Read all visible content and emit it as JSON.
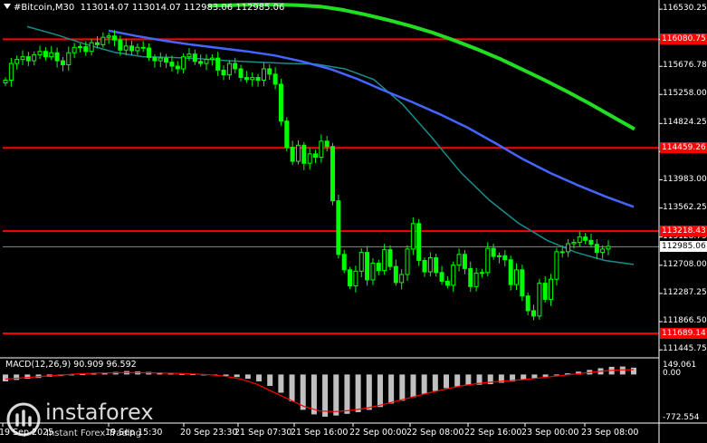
{
  "header": {
    "symbol": "#Bitcoin,M30",
    "ohlc": "113014.07 113014.07 112983.06 112985.06"
  },
  "macd": {
    "label": "MACD(12,26,9) 90.909 96.592"
  },
  "price_axis": {
    "ticks": [
      "116530.25",
      "116076.50",
      "115676.78",
      "115258.00",
      "114824.25",
      "114403.75",
      "113983.00",
      "113562.25",
      "113128.75",
      "112708.00",
      "112287.25",
      "111866.50",
      "111445.75"
    ],
    "tick_values": [
      116530.25,
      116076.5,
      115676.78,
      115258.0,
      114824.25,
      114403.75,
      113983.0,
      113562.25,
      113128.75,
      112708.0,
      112287.25,
      111866.5,
      111445.75
    ]
  },
  "levels": [
    {
      "label": "116080.75",
      "value": 116080.75
    },
    {
      "label": "114459.26",
      "value": 114459.26
    },
    {
      "label": "113218.43",
      "value": 113218.43
    },
    {
      "label": "111689.14",
      "value": 111689.14
    }
  ],
  "current_price": {
    "label": "112985.06",
    "value": 112985.06
  },
  "macd_axis": {
    "ticks": [
      "149.061",
      "0.00",
      "-772.554"
    ],
    "tick_values": [
      149.061,
      0,
      -772.554
    ]
  },
  "time_axis": [
    "19 Sep 2025",
    "19 Sep 15:30",
    "20 Sep 23:30",
    "21 Sep 07:30",
    "21 Sep 16:00",
    "22 Sep 00:00",
    "22 Sep 08:00",
    "22 Sep 16:00",
    "23 Sep 00:00",
    "23 Sep 08:00"
  ],
  "watermark": {
    "name": "instaforex",
    "tagline": "Instant Forex Trading"
  },
  "colors": {
    "background": "#000000",
    "candle": "#00ff00",
    "level": "#ff0000",
    "ma_slow": "#22dd22",
    "ma_mid": "#4466ff",
    "ma_fast": "#1a8c8c",
    "macd_hist": "#c0c0c0",
    "macd_signal": "#ff0000",
    "grid": "#444444"
  },
  "chart_data": {
    "type": "candlestick",
    "ylim": [
      111340,
      116640
    ],
    "close": [
      115470,
      115720,
      115780,
      115820,
      115760,
      115850,
      115900,
      115820,
      115880,
      115760,
      115700,
      115880,
      115960,
      115970,
      115900,
      116030,
      116000,
      116110,
      116130,
      116070,
      115920,
      115980,
      115910,
      115960,
      115950,
      115810,
      115760,
      115800,
      115740,
      115680,
      115640,
      115820,
      115860,
      115750,
      115720,
      115780,
      115800,
      115620,
      115550,
      115720,
      115640,
      115510,
      115480,
      115510,
      115470,
      115640,
      115560,
      115410,
      114860,
      114470,
      114260,
      114500,
      114230,
      114370,
      114320,
      114560,
      114480,
      113670,
      112870,
      112640,
      112400,
      112620,
      112900,
      112490,
      112740,
      112630,
      112940,
      112690,
      112450,
      112570,
      112950,
      113330,
      112780,
      112610,
      112820,
      112600,
      112470,
      112410,
      112710,
      112870,
      112660,
      112390,
      112590,
      112600,
      112960,
      112840,
      112850,
      112790,
      112420,
      112640,
      112250,
      112030,
      111950,
      112440,
      112200,
      112500,
      112910,
      112910,
      113030,
      113050,
      113130,
      113080,
      113020,
      112900,
      112950,
      112990
    ],
    "ma_slow": [
      116580,
      116590,
      116600,
      116600,
      116590,
      116570,
      116520,
      116450,
      116370,
      116280,
      116180,
      116060,
      115930,
      115790,
      115630,
      115470,
      115300,
      115120,
      114930,
      114740
    ],
    "ma_mid": [
      116210,
      116130,
      116060,
      116000,
      115950,
      115900,
      115840,
      115750,
      115640,
      115490,
      115310,
      115140,
      114960,
      114760,
      114530,
      114290,
      114080,
      113900,
      113730,
      113580
    ],
    "ma_fast": [
      116270,
      116150,
      116010,
      115890,
      115820,
      115810,
      115790,
      115760,
      115740,
      115720,
      115710,
      115640,
      115480,
      115110,
      114620,
      114100,
      113680,
      113340,
      113080,
      112900,
      112780,
      112720
    ],
    "macd_hist": [
      -120,
      -95,
      -75,
      -60,
      -40,
      -25,
      -10,
      5,
      15,
      30,
      45,
      60,
      55,
      45,
      35,
      20,
      10,
      5,
      -5,
      -15,
      -25,
      -45,
      -75,
      -120,
      -200,
      -320,
      -470,
      -620,
      -700,
      -740,
      -720,
      -690,
      -660,
      -620,
      -570,
      -510,
      -460,
      -400,
      -340,
      -290,
      -240,
      -210,
      -190,
      -180,
      -170,
      -145,
      -120,
      -90,
      -70,
      -40,
      -10,
      20,
      50,
      80,
      110,
      135,
      140,
      120
    ],
    "macd_signal": [
      -80,
      -60,
      -40,
      -20,
      0,
      15,
      25,
      30,
      35,
      30,
      25,
      20,
      10,
      -5,
      -30,
      -80,
      -170,
      -300,
      -430,
      -560,
      -640,
      -650,
      -630,
      -590,
      -530,
      -460,
      -390,
      -320,
      -260,
      -200,
      -160,
      -130,
      -110,
      -90,
      -60,
      -30,
      0,
      30,
      60,
      80,
      85
    ]
  }
}
